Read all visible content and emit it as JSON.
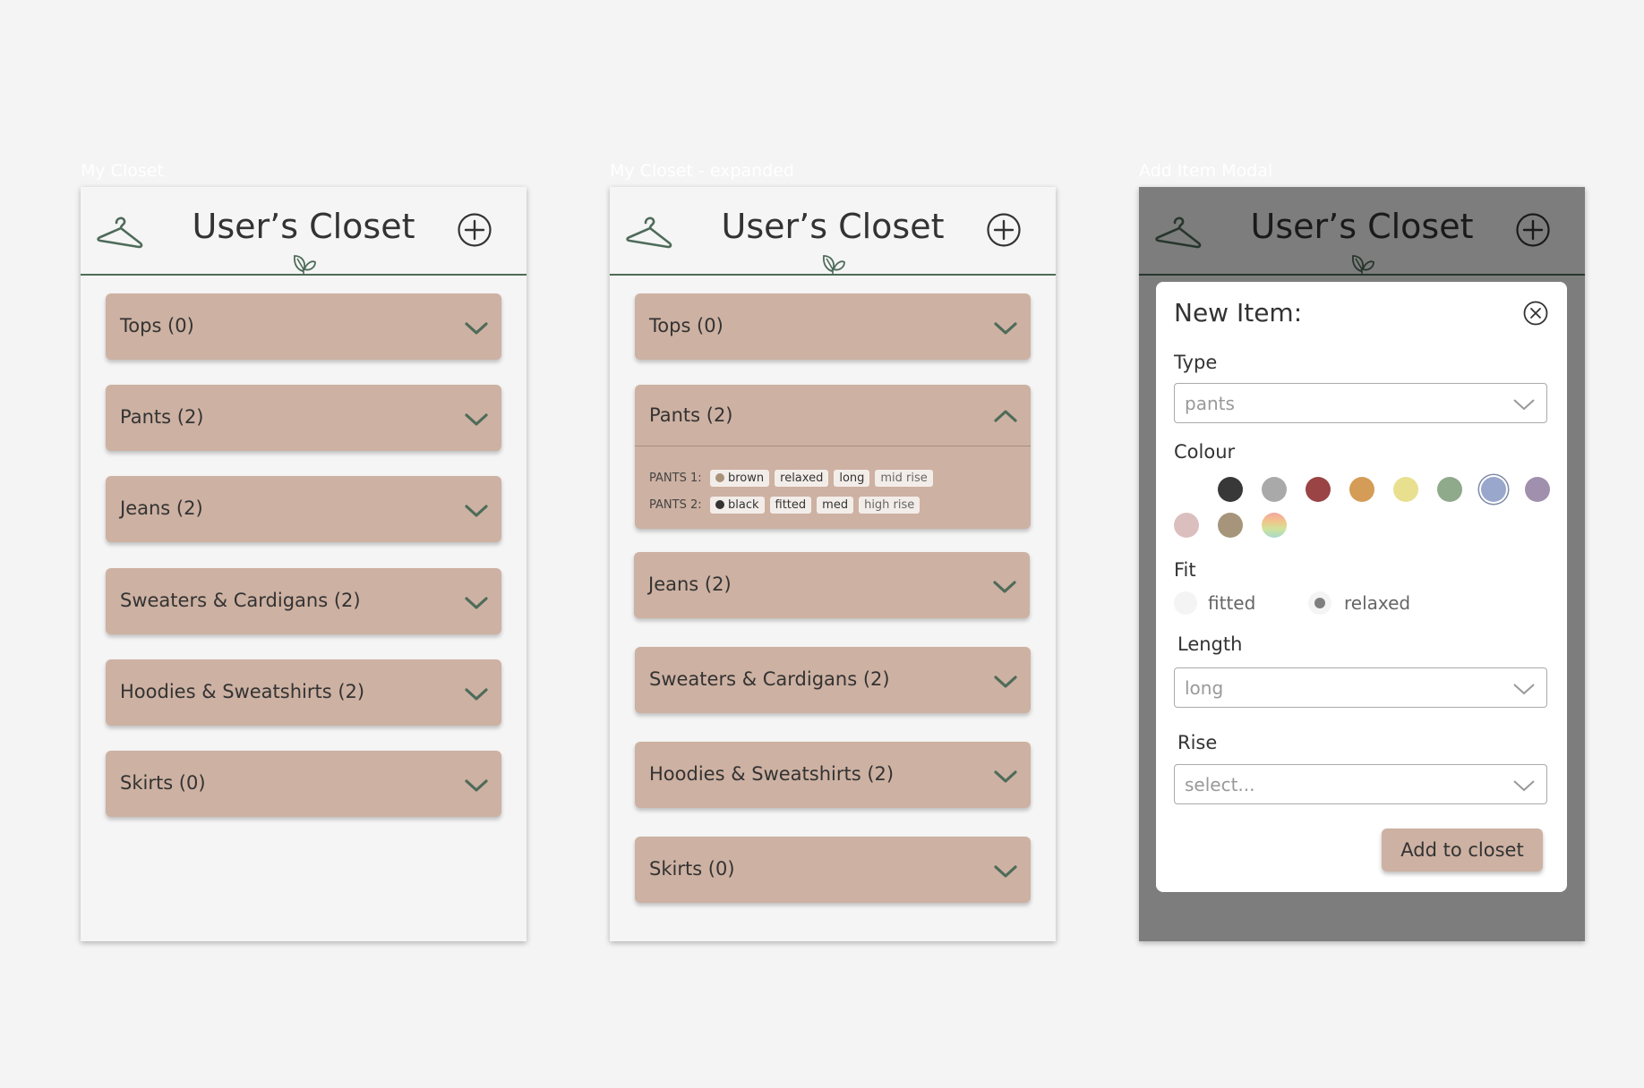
{
  "frames": [
    {
      "label": "My Closet"
    },
    {
      "label": "My Closet - expanded"
    },
    {
      "label": "Add Item Modal"
    }
  ],
  "header": {
    "title": "User’s Closet"
  },
  "categories": [
    {
      "label": "Tops (0)"
    },
    {
      "label": "Pants (2)"
    },
    {
      "label": "Jeans (2)"
    },
    {
      "label": "Sweaters & Cardigans (2)"
    },
    {
      "label": "Hoodies & Sweatshirts (2)"
    },
    {
      "label": "Skirts (0)"
    }
  ],
  "expanded_pants": {
    "items": [
      {
        "label": "PANTS 1:",
        "colour": "brown",
        "colour_hex": "#a89279",
        "fit": "relaxed",
        "length": "long",
        "rise": "mid rise"
      },
      {
        "label": "PANTS 2:",
        "colour": "black",
        "colour_hex": "#333333",
        "fit": "fitted",
        "length": "med",
        "rise": "high rise"
      }
    ]
  },
  "modal": {
    "title": "New Item:",
    "type_label": "Type",
    "type_value": "pants",
    "colour_label": "Colour",
    "colours": [
      "#ffffff",
      "#383838",
      "#a9a9a9",
      "#9a4445",
      "#d49c56",
      "#e8e08f",
      "#8fa98b",
      "#99a7cc",
      "#a18fae",
      "#dbbfbe",
      "#a6957a",
      "rainbow"
    ],
    "selected_colour": "#99a7cc",
    "fit_label": "Fit",
    "fit_options": [
      "fitted",
      "relaxed"
    ],
    "fit_selected": "relaxed",
    "length_label": "Length",
    "length_value": "long",
    "rise_label": "Rise",
    "rise_value": "select...",
    "add_button": "Add to closet"
  },
  "colors": {
    "accent_green": "#4e6b59",
    "category_bg": "#cdb1a2",
    "dimmer": "#7b7b7b"
  }
}
